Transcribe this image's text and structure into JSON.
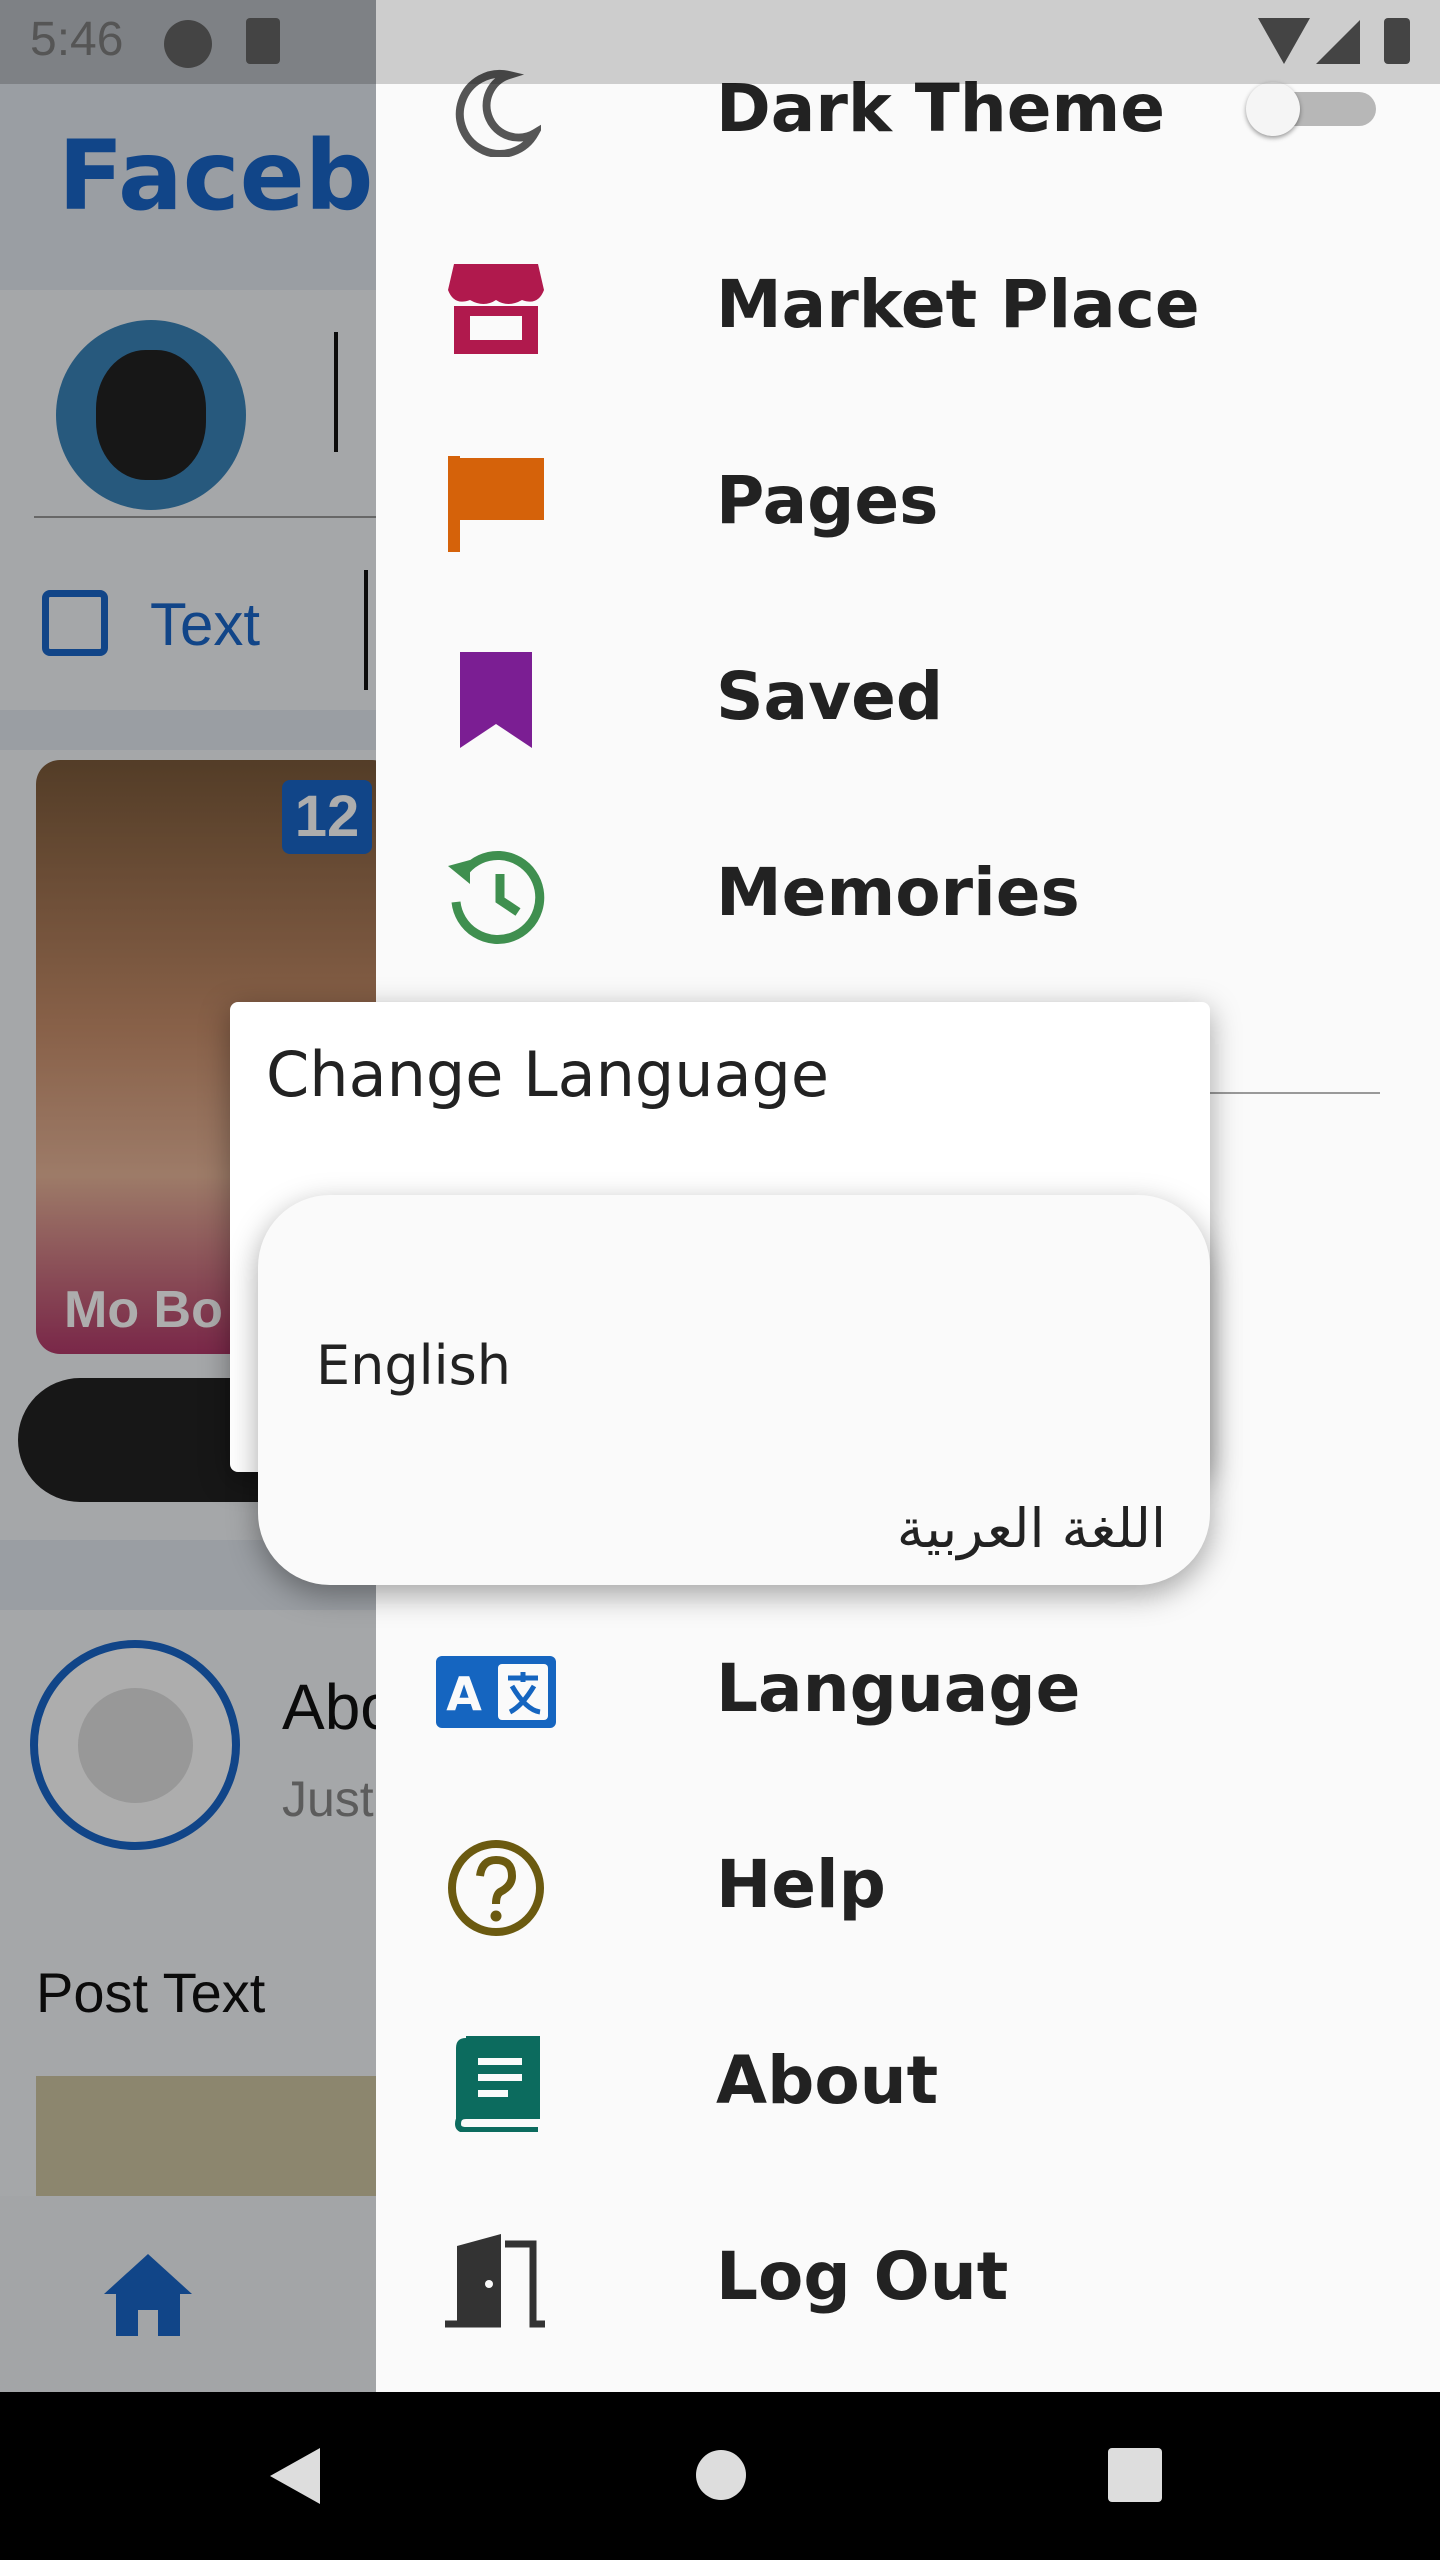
{
  "status_bar": {
    "time": "5:46"
  },
  "background_app": {
    "title": "Facebo",
    "composer_button": "Text",
    "story_count": "12",
    "story_name": "Mo Bo",
    "post_author": "Abo",
    "post_subtitle": "Just",
    "post_text": "Post Text"
  },
  "drawer": {
    "items": [
      {
        "label": "Dark Theme",
        "icon": "moon-icon",
        "color": "#555555"
      },
      {
        "label": "Market Place",
        "icon": "store-icon",
        "color": "#b0194d"
      },
      {
        "label": "Pages",
        "icon": "flag-icon",
        "color": "#d5620a"
      },
      {
        "label": "Saved",
        "icon": "bookmark-icon",
        "color": "#7b1e93"
      },
      {
        "label": "Memories",
        "icon": "history-icon",
        "color": "#3f8f4f"
      },
      {
        "label": "Language",
        "icon": "translate-icon",
        "color": "#1565c0"
      },
      {
        "label": "Help",
        "icon": "help-icon",
        "color": "#6b5a10"
      },
      {
        "label": "About",
        "icon": "book-icon",
        "color": "#0c6b5e"
      },
      {
        "label": "Log Out",
        "icon": "door-icon",
        "color": "#333333"
      }
    ],
    "dark_theme_enabled": false
  },
  "dialog": {
    "title": "Change Language",
    "options": [
      "English",
      "اللغة العربية"
    ]
  }
}
